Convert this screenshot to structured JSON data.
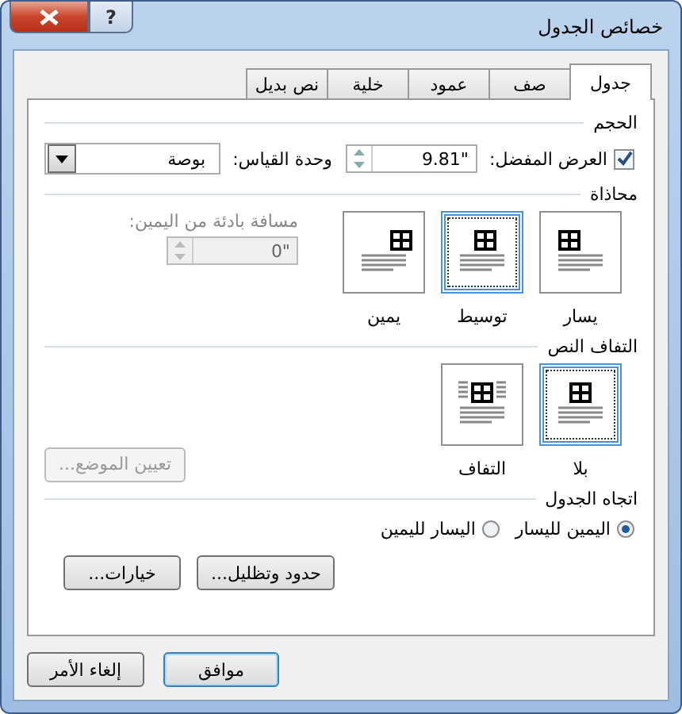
{
  "window": {
    "title": "خصائص الجدول",
    "help": "?"
  },
  "tabs": [
    {
      "label": "جدول",
      "selected": true
    },
    {
      "label": "صف",
      "selected": false
    },
    {
      "label": "عمود",
      "selected": false
    },
    {
      "label": "خلية",
      "selected": false
    },
    {
      "label": "نص بديل",
      "selected": false
    }
  ],
  "size": {
    "heading": "الحجم",
    "preferred_width": {
      "label": "العرض المفضل:",
      "checked": true,
      "value": "9.81\""
    },
    "measure_in": {
      "label": "وحدة القياس:",
      "value": "بوصة"
    }
  },
  "alignment": {
    "heading": "محاذاة",
    "options": [
      {
        "label": "يسار",
        "kind": "left",
        "selected": false
      },
      {
        "label": "توسيط",
        "kind": "center",
        "selected": true
      },
      {
        "label": "يمين",
        "kind": "right",
        "selected": false
      }
    ],
    "indent": {
      "label": "مسافة بادئة من اليمين:",
      "value": "0\"",
      "disabled": true
    }
  },
  "text_wrapping": {
    "heading": "التفاف النص",
    "options": [
      {
        "label": "بلا",
        "kind": "none",
        "selected": true
      },
      {
        "label": "التفاف",
        "kind": "around",
        "selected": false
      }
    ],
    "positioning_button": {
      "label": "تعيين الموضع...",
      "disabled": true
    }
  },
  "direction": {
    "heading": "اتجاه الجدول",
    "options": [
      {
        "label": "اليمين لليسار",
        "selected": true
      },
      {
        "label": "اليسار لليمين",
        "selected": false
      }
    ]
  },
  "panel_buttons": [
    "حدود وتظليل...",
    "خيارات..."
  ],
  "footer_buttons": [
    "موافق",
    "إلغاء الأمر"
  ]
}
